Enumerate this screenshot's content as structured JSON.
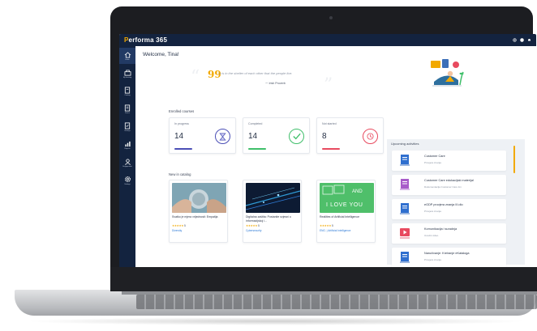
{
  "app": {
    "brand_first": "P",
    "brand_rest": "erforma 365"
  },
  "colors": {
    "nav_bg": "#13233f",
    "accent": "#f2a900",
    "in_progress": "#4b4fb6",
    "completed": "#3fbf6a",
    "not_started": "#e84a5f",
    "link": "#2f7bd6"
  },
  "sidebar": {
    "items": [
      {
        "label": "Home",
        "icon": "home-icon"
      },
      {
        "label": "My learning",
        "icon": "learning-icon"
      },
      {
        "label": "Catalog",
        "icon": "catalog-icon"
      },
      {
        "label": "Forms",
        "icon": "forms-icon"
      },
      {
        "label": "Surveys",
        "icon": "surveys-icon"
      },
      {
        "label": "Reports",
        "icon": "reports-icon"
      },
      {
        "label": "Engagement",
        "icon": "engagement-icon"
      },
      {
        "label": "Settings",
        "icon": "settings-icon"
      }
    ]
  },
  "header": {
    "welcome": "Welcome, Tina!",
    "quote": "It is in the shelter of each other that the people live.",
    "quote_author": "Irish Proverb"
  },
  "enrolled": {
    "title": "Enrolled courses",
    "stats": [
      {
        "label": "In progress",
        "value": "14",
        "icon": "hourglass-icon"
      },
      {
        "label": "Completed",
        "value": "14",
        "icon": "check-circle-icon"
      },
      {
        "label": "Not started",
        "value": "8",
        "icon": "clock-icon"
      }
    ]
  },
  "catalog": {
    "title": "New in catalog",
    "items": [
      {
        "title": "Svatko je mjera vrijednosti: Empatija",
        "stars": "★★★★★",
        "rating": "5",
        "tag": "Diversity",
        "image": "hands-globe-image"
      },
      {
        "title": "Digitalna zaštita: Postanite svjesni o informacijskoj i...",
        "stars": "★★★★★",
        "rating": "5",
        "tag": "Cybersecurity",
        "image": "circuit-image"
      },
      {
        "title": "Realities of Artificial Intelligence",
        "stars": "★★★★★",
        "rating": "5",
        "tag": "ENG. | Artificial Intelligence",
        "image": "robot-i-love-you-image"
      }
    ]
  },
  "upcoming": {
    "title": "Upcoming activities",
    "items": [
      {
        "title": "Customer Care",
        "sub": "Provjera znanja",
        "icon": "document-blue-icon"
      },
      {
        "title": "Customer Care edukacijski materijal",
        "sub": "Dokumentacija Customer Care tim",
        "icon": "document-purple-icon"
      },
      {
        "title": "eGDP provjera znanja III.dio",
        "sub": "Provjera znanja",
        "icon": "document-blue-icon"
      },
      {
        "title": "Komunikacija i suradnja",
        "sub": "Uvodni video",
        "icon": "video-red-icon"
      },
      {
        "title": "Naručivanje: Kreiranje eKataloga",
        "sub": "Provjera znanja",
        "icon": "document-blue-icon"
      }
    ]
  },
  "robot_text": {
    "line1": "AND",
    "line2": "I LOVE YOU"
  }
}
